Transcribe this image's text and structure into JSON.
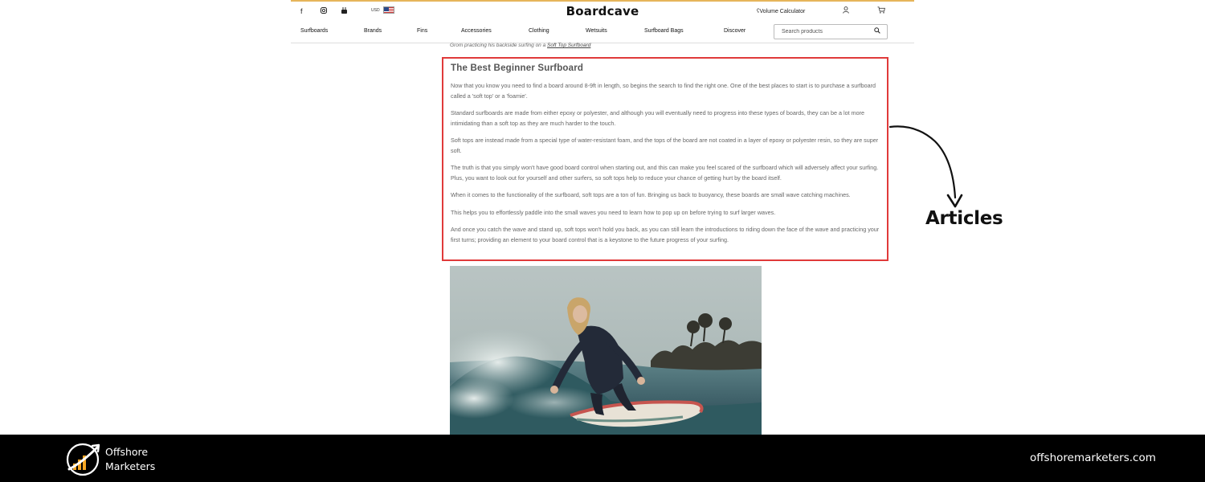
{
  "header": {
    "currency": "USD",
    "logo": "Boardcave",
    "volume_calculator": "Volume Calculator",
    "social_icons": [
      "facebook-icon",
      "instagram-icon",
      "youtube-icon"
    ]
  },
  "nav": {
    "items": [
      "Surfboards",
      "Brands",
      "Fins",
      "Accessories",
      "Clothing",
      "Wetsuits",
      "Surfboard Bags",
      "Discover"
    ],
    "search_placeholder": "Search products"
  },
  "caption": {
    "text": "Grom practicing his backside surfing on a ",
    "link": "Soft Top Surfboard"
  },
  "article": {
    "title": "The Best Beginner Surfboard",
    "paragraphs": [
      "Now that you know you need to find a board around 8-9ft in length, so begins the search to find the right one. One of the best places to start is to purchase a surfboard called a 'soft top' or a 'foamie'.",
      "Standard surfboards are made from either epoxy or polyester, and although you will eventually need to progress into these types of boards, they can be a lot more intimidating than a soft top as they are much harder to the touch.",
      "Soft tops are instead made from a special type of water-resistant foam, and the tops of the board are not coated in a layer of epoxy or polyester resin, so they are super soft.",
      "The truth is that you simply won't have good board control when starting out, and this can make you feel scared of the surfboard which will adversely affect your surfing. Plus, you want to look out for yourself and other surfers, so soft tops help to reduce your chance of getting hurt by the board itself.",
      "When it comes to the functionality of the surfboard, soft tops are a ton of fun. Bringing us back to buoyancy, these boards are small wave catching machines.",
      "This helps you to effortlessly paddle into the small waves you need to learn how to pop up on before trying to surf larger waves.",
      "And once you catch the wave and stand up, soft tops won't hold you back, as you can still learn the introductions to riding down the face of the wave and practicing your first turns; providing an element to your board control that is a keystone to the future progress of your surfing."
    ]
  },
  "annotation": {
    "label": "Articles"
  },
  "footer": {
    "brand_line1": "Offshore",
    "brand_line2": "Marketers",
    "url": "offshoremarketers.com"
  },
  "colors": {
    "highlight": "#e03a3a",
    "footer_bg": "#000000",
    "logo_orange": "#f5a623"
  }
}
